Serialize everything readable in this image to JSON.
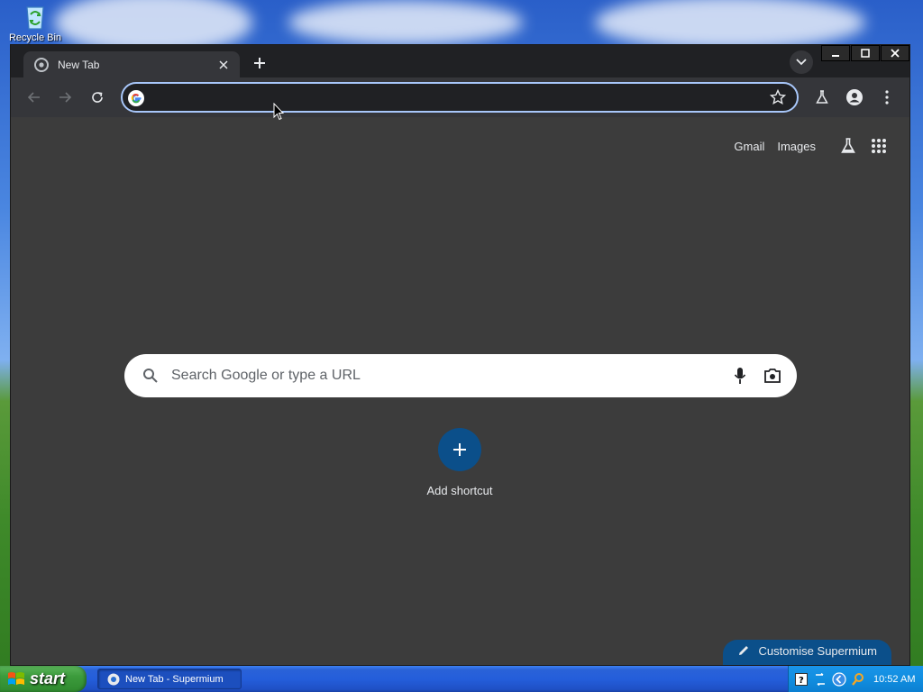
{
  "desktop": {
    "recycle_bin_label": "Recycle Bin"
  },
  "browser": {
    "tab": {
      "title": "New Tab"
    },
    "omnibox": {
      "value": "",
      "placeholder": ""
    },
    "header_links": {
      "gmail": "Gmail",
      "images": "Images"
    },
    "search": {
      "placeholder": "Search Google or type a URL"
    },
    "shortcut": {
      "label": "Add shortcut"
    },
    "customise": {
      "label": "Customise Supermium"
    },
    "colors": {
      "background": "#3c3c3c",
      "accent": "#0b4f8a",
      "omnibox_border": "#a8c7fa"
    }
  },
  "taskbar": {
    "start_label": "start",
    "task_label": "New Tab - Supermium",
    "clock": "10:52 AM"
  }
}
